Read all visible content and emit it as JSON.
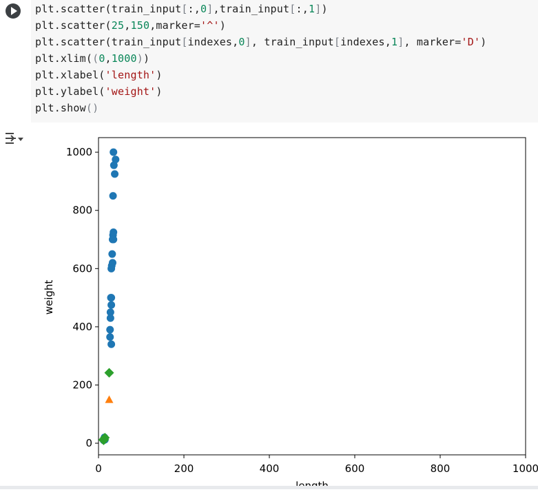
{
  "code": {
    "lines": [
      [
        {
          "t": "plt.scatter(train_input",
          "c": ""
        },
        {
          "t": "[",
          "c": "br"
        },
        {
          "t": ":,",
          "c": ""
        },
        {
          "t": "0",
          "c": "num"
        },
        {
          "t": "]",
          "c": "br"
        },
        {
          "t": ",train_input",
          "c": ""
        },
        {
          "t": "[",
          "c": "br"
        },
        {
          "t": ":,",
          "c": ""
        },
        {
          "t": "1",
          "c": "num"
        },
        {
          "t": "]",
          "c": "br"
        },
        {
          "t": ")",
          "c": ""
        }
      ],
      [
        {
          "t": "plt.scatter(",
          "c": ""
        },
        {
          "t": "25",
          "c": "num"
        },
        {
          "t": ",",
          "c": ""
        },
        {
          "t": "150",
          "c": "num"
        },
        {
          "t": ",marker=",
          "c": ""
        },
        {
          "t": "'^'",
          "c": "str"
        },
        {
          "t": ")",
          "c": ""
        }
      ],
      [
        {
          "t": "plt.scatter(train_input",
          "c": ""
        },
        {
          "t": "[",
          "c": "br"
        },
        {
          "t": "indexes,",
          "c": ""
        },
        {
          "t": "0",
          "c": "num"
        },
        {
          "t": "]",
          "c": "br"
        },
        {
          "t": ", train_input",
          "c": ""
        },
        {
          "t": "[",
          "c": "br"
        },
        {
          "t": "indexes,",
          "c": ""
        },
        {
          "t": "1",
          "c": "num"
        },
        {
          "t": "]",
          "c": "br"
        },
        {
          "t": ", marker=",
          "c": ""
        },
        {
          "t": "'D'",
          "c": "str"
        },
        {
          "t": ")",
          "c": ""
        }
      ],
      [
        {
          "t": "plt.xlim(",
          "c": ""
        },
        {
          "t": "(",
          "c": "br"
        },
        {
          "t": "0",
          "c": "num"
        },
        {
          "t": ",",
          "c": ""
        },
        {
          "t": "1000",
          "c": "num"
        },
        {
          "t": ")",
          "c": "br"
        },
        {
          "t": ")",
          "c": ""
        }
      ],
      [
        {
          "t": "plt.xlabel(",
          "c": ""
        },
        {
          "t": "'length'",
          "c": "str"
        },
        {
          "t": ")",
          "c": ""
        }
      ],
      [
        {
          "t": "plt.ylabel(",
          "c": ""
        },
        {
          "t": "'weight'",
          "c": "str"
        },
        {
          "t": ")",
          "c": ""
        }
      ],
      [
        {
          "t": "plt.show",
          "c": ""
        },
        {
          "t": "()",
          "c": "br"
        }
      ]
    ]
  },
  "chart_data": {
    "type": "scatter",
    "xlabel": "length",
    "ylabel": "weight",
    "xlim": [
      0,
      1000
    ],
    "ylim": [
      -40,
      1050
    ],
    "xticks": [
      "0",
      "200",
      "400",
      "600",
      "800",
      "1000"
    ],
    "yticks": [
      "0",
      "200",
      "400",
      "600",
      "800",
      "1000"
    ],
    "series": [
      {
        "marker": "circle",
        "color": "#1f77b4",
        "points": [
          [
            35,
            1000
          ],
          [
            40,
            975
          ],
          [
            36,
            955
          ],
          [
            38,
            925
          ],
          [
            34,
            850
          ],
          [
            35,
            725
          ],
          [
            34,
            715
          ],
          [
            33,
            700
          ],
          [
            35,
            700
          ],
          [
            32,
            650
          ],
          [
            33,
            620
          ],
          [
            31,
            610
          ],
          [
            30,
            600
          ],
          [
            29,
            500
          ],
          [
            30,
            500
          ],
          [
            30,
            475
          ],
          [
            28,
            450
          ],
          [
            28,
            430
          ],
          [
            27,
            390
          ],
          [
            27,
            365
          ],
          [
            30,
            340
          ],
          [
            12,
            10
          ],
          [
            13,
            15
          ],
          [
            14,
            20
          ],
          [
            15,
            12
          ]
        ]
      },
      {
        "marker": "triangle",
        "color": "#ff7f0e",
        "points": [
          [
            25,
            150
          ]
        ]
      },
      {
        "marker": "diamond",
        "color": "#2ca02c",
        "points": [
          [
            25,
            242
          ],
          [
            15,
            19
          ],
          [
            13,
            13
          ],
          [
            11,
            12
          ],
          [
            12,
            10
          ]
        ]
      }
    ]
  }
}
